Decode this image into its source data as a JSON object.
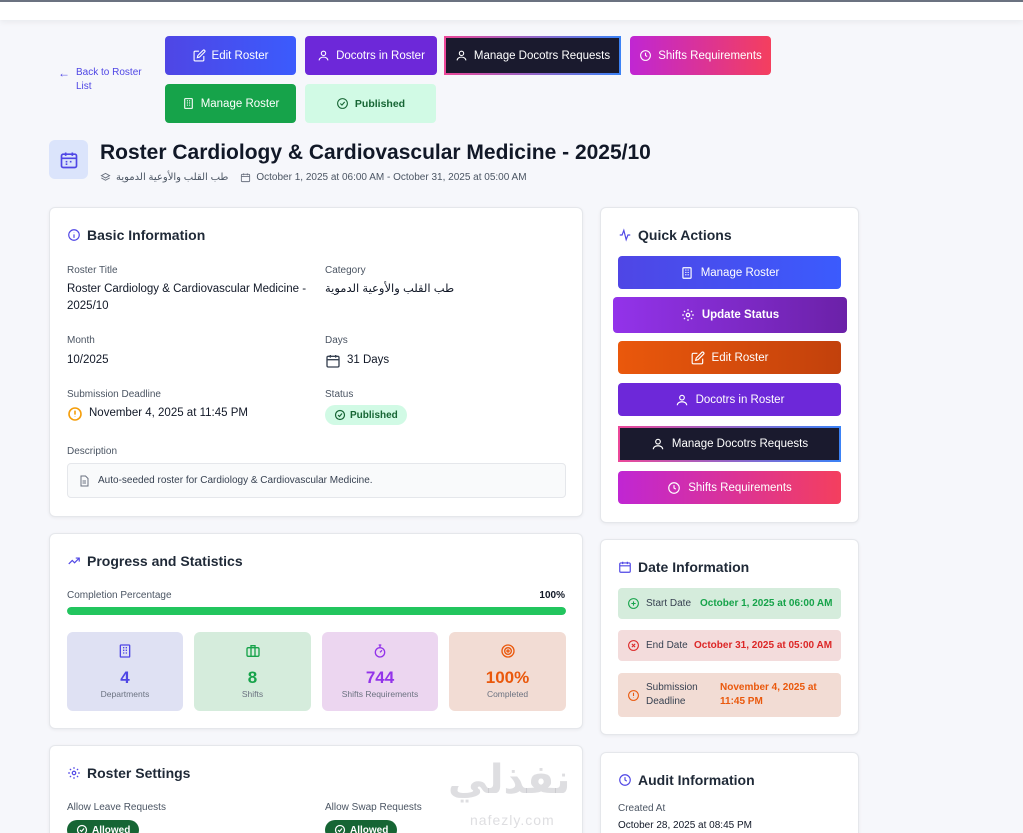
{
  "header": {
    "back_label": "Back to Roster List",
    "buttons": {
      "edit_roster": "Edit Roster",
      "doctors_in_roster": "Docotrs in Roster",
      "manage_requests": "Manage Docotrs Requests",
      "shifts_requirements": "Shifts Requirements",
      "manage_roster": "Manage Roster",
      "published": "Published"
    },
    "title": "Roster Cardiology & Cardiovascular Medicine - 2025/10",
    "category": "طب القلب والأوعية الدموية",
    "date_range": "October 1, 2025 at 06:00 AM - October 31, 2025 at 05:00 AM"
  },
  "basic_info": {
    "title": "Basic Information",
    "roster_title_label": "Roster Title",
    "roster_title_value": "Roster Cardiology & Cardiovascular Medicine - 2025/10",
    "category_label": "Category",
    "category_value": "طب القلب والأوعية الدموية",
    "month_label": "Month",
    "month_value": "10/2025",
    "days_label": "Days",
    "days_value": "31 Days",
    "deadline_label": "Submission Deadline",
    "deadline_value": "November 4, 2025 at 11:45 PM",
    "status_label": "Status",
    "status_value": "Published",
    "description_label": "Description",
    "description_value": "Auto-seeded roster for Cardiology & Cardiovascular Medicine."
  },
  "progress": {
    "title": "Progress and Statistics",
    "completion_label": "Completion Percentage",
    "completion_value": "100%",
    "completion_fraction": 1.0,
    "stats": [
      {
        "value": "4",
        "label": "Departments"
      },
      {
        "value": "8",
        "label": "Shifts"
      },
      {
        "value": "744",
        "label": "Shifts Requirements"
      },
      {
        "value": "100%",
        "label": "Completed"
      }
    ]
  },
  "settings": {
    "title": "Roster Settings",
    "leave_label": "Allow Leave Requests",
    "leave_value": "Allowed",
    "swap_label": "Allow Swap Requests",
    "swap_value": "Allowed"
  },
  "quick_actions": {
    "title": "Quick Actions",
    "manage_roster": "Manage Roster",
    "update_status": "Update Status",
    "edit_roster": "Edit Roster",
    "doctors_in_roster": "Docotrs in Roster",
    "manage_requests": "Manage Docotrs Requests",
    "shifts_requirements": "Shifts Requirements"
  },
  "date_info": {
    "title": "Date Information",
    "start_label": "Start Date",
    "start_value": "October 1, 2025 at 06:00 AM",
    "end_label": "End Date",
    "end_value": "October 31, 2025 at 05:00 AM",
    "deadline_label": "Submission Deadline",
    "deadline_value": "November 4, 2025 at 11:45 PM"
  },
  "audit": {
    "title": "Audit Information",
    "created_label": "Created At",
    "created_value": "October 28, 2025 at 08:45 PM"
  },
  "watermark": {
    "text": "نفذلي",
    "sub": "nafezly.com"
  }
}
